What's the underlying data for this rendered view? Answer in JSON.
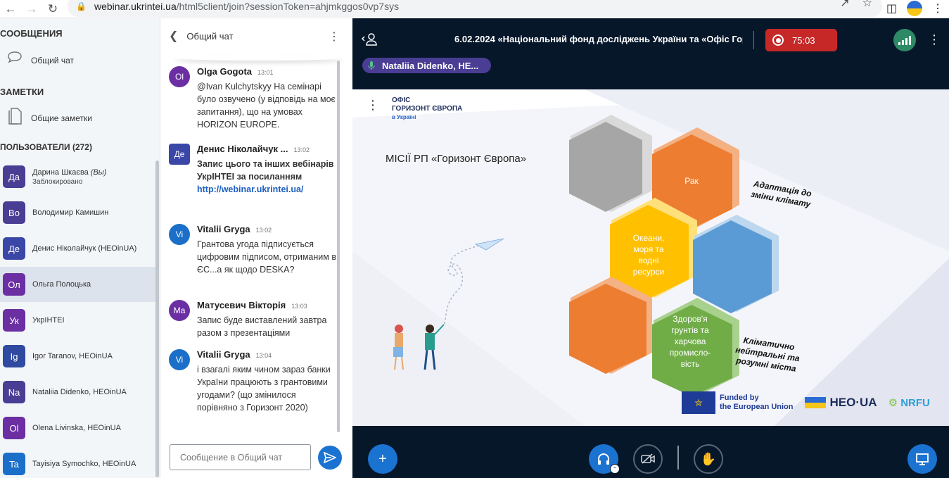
{
  "browser": {
    "url_domain": "webinar.ukrintei.ua",
    "url_path": "/html5client/join?sessionToken=ahjmkggos0vp7sys"
  },
  "sidebar": {
    "messages_title": "СООБЩЕНИЯ",
    "public_chat": "Общий чат",
    "notes_title": "ЗАМЕТКИ",
    "shared_notes": "Общие заметки",
    "users_title": "ПОЛЬЗОВАТЕЛИ (272)",
    "users": [
      {
        "initials": "Да",
        "name": "Дарина Шкаєва",
        "you": "(Вы)",
        "status": "Заблокировано",
        "color": "#4a3d94",
        "state": "green"
      },
      {
        "initials": "Во",
        "name": "Володимир Камишин",
        "color": "#4a3d94",
        "state": "red"
      },
      {
        "initials": "Де",
        "name": "Денис Ніколайчук (HEOinUA)",
        "color": "#3b47a7",
        "state": "red"
      },
      {
        "initials": "Ол",
        "name": "Ольга Полоцька",
        "color": "#6b2fa3",
        "state": "red"
      },
      {
        "initials": "Ук",
        "name": "УкрІНТЕІ",
        "color": "#6b2fa3",
        "state": "red"
      },
      {
        "initials": "Ig",
        "name": "Igor Taranov, HEOinUA",
        "color": "#2f4aa0",
        "state": "red"
      },
      {
        "initials": "Na",
        "name": "Nataliia Didenko, HEOinUA",
        "color": "#4a3d94",
        "state": "green"
      },
      {
        "initials": "Ol",
        "name": "Olena Livinska, HEOinUA",
        "color": "#6b2fa3",
        "state": "red"
      },
      {
        "initials": "Ta",
        "name": "Tayisiya Symochko, HEOinUA",
        "color": "#1b6fc9",
        "state": "red"
      }
    ]
  },
  "chat": {
    "title": "Общий чат",
    "input_placeholder": "Сообщение в Общий чат",
    "messages": [
      {
        "initials": "Ol",
        "author": "Olga Gogota",
        "time": "13:01",
        "text": "@Ivan Kulchytskyy На семінарі було озвучено (у відповідь на моє запитання), що на умовах HORIZON EUROPE.",
        "color": "#6b2fa3"
      },
      {
        "initials": "Де",
        "author": "Денис Ніколайчук ...",
        "time": "13:02",
        "text": "Запис цього та інших вебінарів УкрІНТЕІ за посиланням",
        "link": "http://webinar.ukrintei.ua/",
        "color": "#3b47a7"
      },
      {
        "initials": "Vi",
        "author": "Vitalii Gryga",
        "time": "13:02",
        "text": "Грантова угода підписується цифровим підписом, отриманим в ЄС...а як щодо DESKA?",
        "color": "#1b6fc9"
      },
      {
        "initials": "Ма",
        "author": "Матусевич Вікторія",
        "time": "13:03",
        "text": "Запис буде виставлений завтра разом з презентаціями",
        "color": "#6b2fa3"
      },
      {
        "initials": "Vi",
        "author": "Vitalii Gryga",
        "time": "13:04",
        "text": "і взагалі яким чином зараз банки України працюють з грантовими угодами? (що змінилося порівняно з Горизонт 2020)",
        "color": "#1b6fc9"
      }
    ]
  },
  "stage": {
    "meeting_title": "6.02.2024 «Національний фонд досліджень України та «Офіс Гор...",
    "timer": "75:03",
    "speaker": "Nataliia Didenko, HE...",
    "colors": {
      "record": "#c62828",
      "signal": "#2e8a66",
      "primary": "#1b73d1"
    }
  },
  "slide": {
    "logo_line1": "ОФІС",
    "logo_line2": "ГОРИЗОНТ ЄВРОПА",
    "logo_line3": "в Україні",
    "title": "МІСІЇ РП «Горизонт Європа»",
    "hex_cancer": "Рак",
    "hex_oceans": "Океани, моря та водні ресурси",
    "hex_soil": "Здоров'я грунтів та харчова промисло-вість",
    "label_climate": "Адаптація до зміни клімату",
    "label_cities": "Кліматично нейтральні та розумні міста",
    "eu_text_1": "Funded by",
    "eu_text_2": "the European Union",
    "heo": "HEO·UA",
    "nrfu": "NRFU"
  }
}
